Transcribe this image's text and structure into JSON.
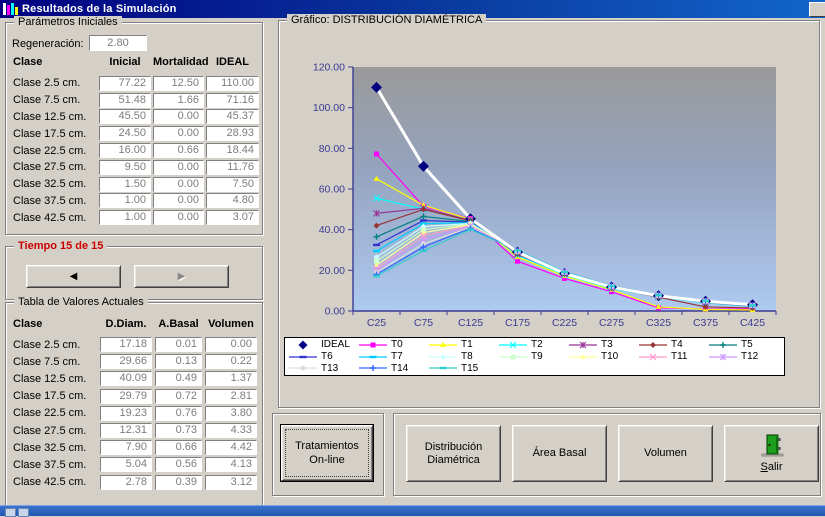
{
  "window": {
    "title": "Resultados de la Simulación"
  },
  "icons": {
    "app_icon": "bar-chart-icon",
    "prev": "◀",
    "next": "▶",
    "exit_icon": "green-door"
  },
  "parametros": {
    "title": "Parámetros  Iniciales",
    "regeneracion_label": "Regeneración:",
    "regeneracion_value": "2.80",
    "headers": [
      "Clase",
      "Inicial",
      "Mortalidad",
      "IDEAL"
    ],
    "rows": [
      {
        "clase": "Clase 2.5 cm.",
        "inicial": "77.22",
        "mortalidad": "12.50",
        "ideal": "110.00"
      },
      {
        "clase": "Clase 7.5 cm.",
        "inicial": "51.48",
        "mortalidad": "1.66",
        "ideal": "71.16"
      },
      {
        "clase": "Clase 12.5 cm.",
        "inicial": "45.50",
        "mortalidad": "0.00",
        "ideal": "45.37"
      },
      {
        "clase": "Clase 17.5 cm.",
        "inicial": "24.50",
        "mortalidad": "0.00",
        "ideal": "28.93"
      },
      {
        "clase": "Clase 22.5 cm.",
        "inicial": "16.00",
        "mortalidad": "0.66",
        "ideal": "18.44"
      },
      {
        "clase": "Clase 27.5 cm.",
        "inicial": "9.50",
        "mortalidad": "0.00",
        "ideal": "11.76"
      },
      {
        "clase": "Clase 32.5 cm.",
        "inicial": "1.50",
        "mortalidad": "0.00",
        "ideal": "7.50"
      },
      {
        "clase": "Clase 37.5 cm.",
        "inicial": "1.00",
        "mortalidad": "0.00",
        "ideal": "4.80"
      },
      {
        "clase": "Clase 42.5 cm.",
        "inicial": "1.00",
        "mortalidad": "0.00",
        "ideal": "3.07"
      }
    ]
  },
  "tiempo": {
    "label": "Tiempo 15 de 15",
    "prev_icon": "◀",
    "next_icon": "▶"
  },
  "tabla_actuales": {
    "title": "Tabla de Valores Actuales",
    "headers": [
      "Clase",
      "D.Diam.",
      "A.Basal",
      "Volumen"
    ],
    "rows": [
      {
        "clase": "Clase 2.5 cm.",
        "ddiam": "17.18",
        "abasal": "0.01",
        "volumen": "0.00"
      },
      {
        "clase": "Clase 7.5 cm.",
        "ddiam": "29.66",
        "abasal": "0.13",
        "volumen": "0.22"
      },
      {
        "clase": "Clase 12.5 cm.",
        "ddiam": "40.09",
        "abasal": "0.49",
        "volumen": "1.37"
      },
      {
        "clase": "Clase 17.5 cm.",
        "ddiam": "29.79",
        "abasal": "0.72",
        "volumen": "2.81"
      },
      {
        "clase": "Clase 22.5 cm.",
        "ddiam": "19.23",
        "abasal": "0.76",
        "volumen": "3.80"
      },
      {
        "clase": "Clase 27.5 cm.",
        "ddiam": "12.31",
        "abasal": "0.73",
        "volumen": "4.33"
      },
      {
        "clase": "Clase 32.5 cm.",
        "ddiam": "7.90",
        "abasal": "0.66",
        "volumen": "4.42"
      },
      {
        "clase": "Clase 37.5 cm.",
        "ddiam": "5.04",
        "abasal": "0.56",
        "volumen": "4.13"
      },
      {
        "clase": "Clase 42.5 cm.",
        "ddiam": "2.78",
        "abasal": "0.39",
        "volumen": "3.12"
      }
    ]
  },
  "grafico": {
    "title": "Gráfico: DISTRIBUCIÓN DIAMÉTRICA"
  },
  "chart_data": {
    "type": "line",
    "title": "Gráfico: DISTRIBUCIÓN DIAMÉTRICA",
    "categories": [
      "C25",
      "C75",
      "C125",
      "C175",
      "C225",
      "C275",
      "C325",
      "C375",
      "C425"
    ],
    "ylim": [
      0,
      120
    ],
    "y_tick_step": 20,
    "grid": false,
    "legend_position": "bottom",
    "legend_rows": [
      7,
      7,
      3
    ],
    "plot_bg_gradient": [
      "#9A9A9A",
      "#95A3BE",
      "#AECAF0"
    ],
    "axis_color": "#3B3B93",
    "series": [
      {
        "name": "IDEAL",
        "color": "#000080",
        "line_color": "#FFFFFF",
        "line_width": 3,
        "marker": "diamond",
        "marker_size": 5.5,
        "values": [
          110.0,
          71.16,
          45.37,
          28.93,
          18.44,
          11.76,
          7.5,
          4.8,
          3.07
        ]
      },
      {
        "name": "T0",
        "color": "#FF00FF",
        "marker": "square",
        "values": [
          77.22,
          51.48,
          45.5,
          24.5,
          16.0,
          9.5,
          1.5,
          1.0,
          1.0
        ]
      },
      {
        "name": "T1",
        "color": "#FFFF00",
        "marker": "triangle",
        "values": [
          65.0,
          52.0,
          45.1,
          26.5,
          17.2,
          10.5,
          2.0,
          0.8,
          0.5
        ]
      },
      {
        "name": "T2",
        "color": "#00FFFF",
        "marker": "x",
        "values": [
          55.5,
          50.0,
          44.8,
          27.5,
          17.8,
          11.0,
          7.0,
          4.0,
          2.2
        ]
      },
      {
        "name": "T3",
        "color": "#993399",
        "marker": "asterisk",
        "values": [
          48.0,
          50.5,
          44.6,
          28.0,
          18.2,
          11.3,
          7.2,
          4.2,
          2.4
        ]
      },
      {
        "name": "T4",
        "color": "#993333",
        "marker": "diamond",
        "values": [
          42.0,
          50.0,
          44.3,
          28.3,
          18.4,
          11.5,
          6.8,
          2.0,
          1.5
        ]
      },
      {
        "name": "T5",
        "color": "#008080",
        "marker": "plus",
        "values": [
          36.5,
          46.5,
          44.0,
          28.6,
          18.6,
          11.7,
          7.3,
          4.5,
          2.5
        ]
      },
      {
        "name": "T6",
        "color": "#3333CC",
        "marker": "dash",
        "values": [
          32.5,
          44.5,
          43.7,
          28.8,
          18.7,
          11.8,
          7.4,
          4.6,
          2.6
        ]
      },
      {
        "name": "T7",
        "color": "#00CCFF",
        "marker": "dash",
        "values": [
          29.5,
          43.0,
          43.4,
          29.0,
          18.8,
          11.9,
          7.5,
          4.7,
          2.6
        ]
      },
      {
        "name": "T8",
        "color": "#CCFFFF",
        "marker": "diamond",
        "values": [
          26.5,
          41.5,
          43.1,
          29.1,
          18.9,
          12.0,
          7.6,
          4.7,
          2.7
        ]
      },
      {
        "name": "T9",
        "color": "#CCFFCC",
        "marker": "square",
        "values": [
          24.5,
          40.0,
          42.8,
          29.2,
          19.0,
          12.0,
          7.6,
          4.8,
          2.7
        ]
      },
      {
        "name": "T10",
        "color": "#FFFF99",
        "marker": "triangle",
        "values": [
          22.5,
          38.5,
          42.4,
          29.3,
          19.0,
          12.1,
          7.7,
          4.8,
          2.7
        ]
      },
      {
        "name": "T11",
        "color": "#FF99CC",
        "marker": "x",
        "values": [
          21.0,
          37.0,
          42.0,
          29.4,
          19.1,
          12.1,
          7.7,
          4.9,
          2.7
        ]
      },
      {
        "name": "T12",
        "color": "#CC99FF",
        "marker": "asterisk",
        "values": [
          20.0,
          35.0,
          41.6,
          29.5,
          19.1,
          12.2,
          7.8,
          4.9,
          2.8
        ]
      },
      {
        "name": "T13",
        "color": "#DDDDDD",
        "marker": "circle",
        "values": [
          19.0,
          33.0,
          41.2,
          29.6,
          19.2,
          12.2,
          7.8,
          5.0,
          2.8
        ]
      },
      {
        "name": "T14",
        "color": "#3366FF",
        "marker": "plus",
        "values": [
          18.0,
          31.5,
          40.7,
          29.7,
          19.2,
          12.3,
          7.9,
          5.0,
          2.8
        ]
      },
      {
        "name": "T15",
        "color": "#33CCCC",
        "marker": "dash",
        "values": [
          17.18,
          29.66,
          40.09,
          29.79,
          19.23,
          12.31,
          7.9,
          5.04,
          2.78
        ]
      }
    ]
  },
  "buttons": {
    "tratamientos_line1": "Tratamientos",
    "tratamientos_line2": "On-line",
    "distribucion_line1": "Distribución",
    "distribucion_line2": "Diamétrica",
    "area_basal": "Área Basal",
    "volumen": "Volumen",
    "salir_accel": "S",
    "salir_rest": "alir"
  }
}
